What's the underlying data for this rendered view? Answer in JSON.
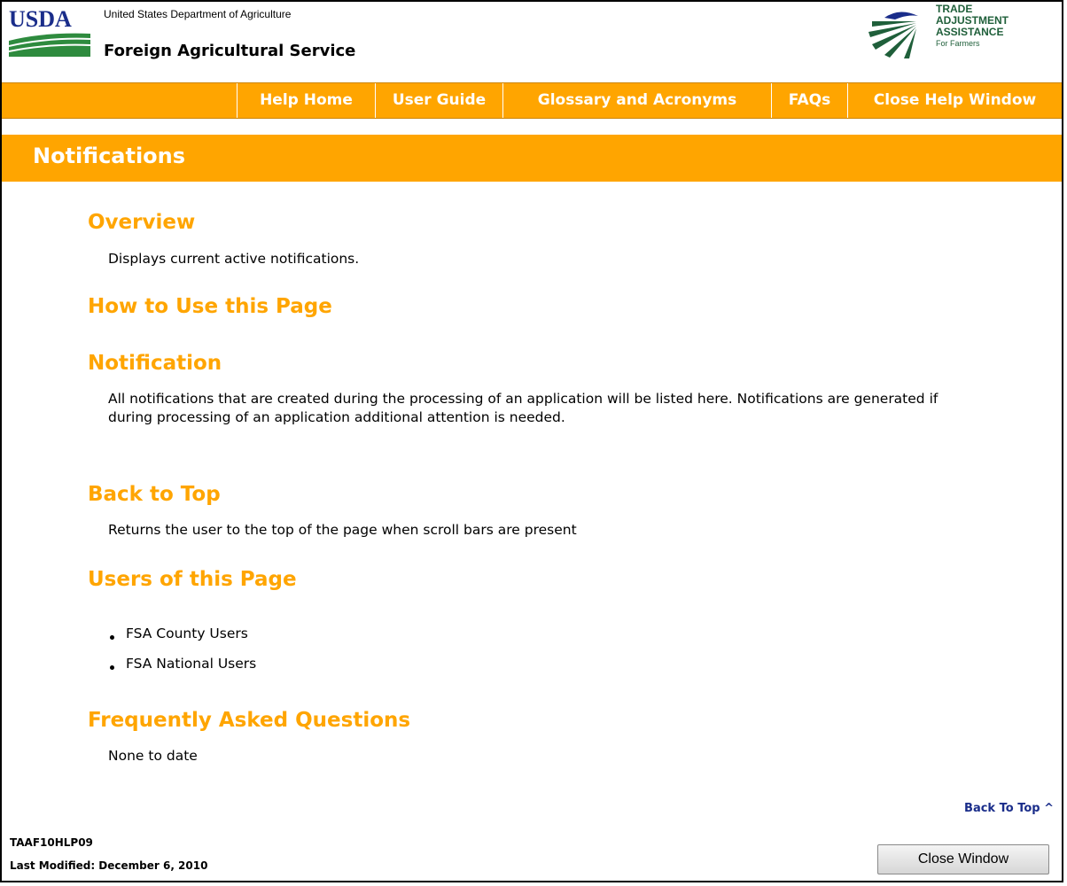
{
  "header": {
    "department": "United States Department of Agriculture",
    "agency": "Foreign Agricultural Service",
    "usda_logo_text": "USDA",
    "taa_logo_lines": [
      "TRADE",
      "ADJUSTMENT",
      "ASSISTANCE",
      "For Farmers"
    ]
  },
  "nav": {
    "items": [
      {
        "label": "Help Home"
      },
      {
        "label": "User Guide"
      },
      {
        "label": "Glossary and Acronyms"
      },
      {
        "label": "FAQs"
      },
      {
        "label": "Close Help Window"
      }
    ]
  },
  "page": {
    "title": "Notifications",
    "sections": [
      {
        "heading": "Overview",
        "text": "Displays current active notifications."
      },
      {
        "heading": "How to Use this Page",
        "text": ""
      },
      {
        "heading": "Notification",
        "text": "All notifications that are created during the processing of an application will be listed here. Notifications are generated if during processing of an application additional attention is needed."
      },
      {
        "heading": "Back to Top",
        "text": "Returns the user to the top of the page when scroll bars are present"
      },
      {
        "heading": "Users of this Page",
        "text": ""
      },
      {
        "heading": "Frequently Asked Questions",
        "text": "None to date"
      }
    ],
    "users": [
      "FSA County Users",
      "FSA National Users"
    ]
  },
  "footer": {
    "back_to_top": "Back To Top ^",
    "page_code": "TAAF10HLP09",
    "last_modified": "Last Modified: December 6, 2010",
    "close_button": "Close Window"
  },
  "colors": {
    "accent_orange": "#ffa500",
    "taa_green": "#1f5f3a",
    "usda_blue": "#1a2d8a",
    "usda_green": "#2e8b3e"
  }
}
